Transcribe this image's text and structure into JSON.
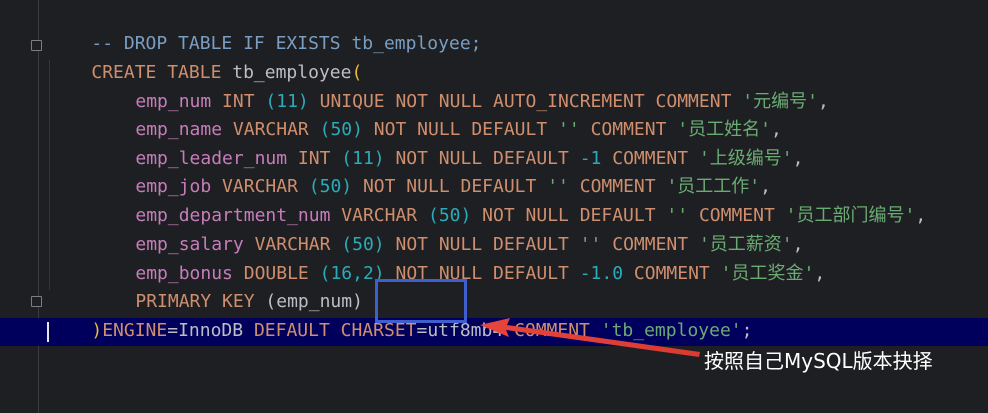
{
  "code": {
    "line1": "-- DROP TABLE IF EXISTS tb_employee;",
    "line2": {
      "create_table": "CREATE TABLE",
      "table_name": " tb_employee",
      "open_paren": "("
    },
    "line3": {
      "column": "emp_num",
      "type": " INT ",
      "size": "(11)",
      "constraints": " UNIQUE NOT NULL AUTO_INCREMENT COMMENT ",
      "comment": "'元编号'",
      "end": ","
    },
    "line4": {
      "column": "emp_name",
      "type": " VARCHAR ",
      "size": "(50)",
      "constraints": " NOT NULL DEFAULT ",
      "default": "''",
      "comment_kw": " COMMENT ",
      "comment": "'员工姓名'",
      "end": ","
    },
    "line5": {
      "column": "emp_leader_num",
      "type": " INT ",
      "size": "(11)",
      "constraints": " NOT NULL DEFAULT ",
      "default": "-1",
      "comment_kw": " COMMENT ",
      "comment": "'上级编号'",
      "end": ","
    },
    "line6": {
      "column": "emp_job",
      "type": " VARCHAR ",
      "size": "(50)",
      "constraints": " NOT NULL DEFAULT ",
      "default": "''",
      "comment_kw": " COMMENT ",
      "comment": "'员工工作'",
      "end": ","
    },
    "line7": {
      "column": "emp_department_num",
      "type": " VARCHAR ",
      "size": "(50)",
      "constraints": " NOT NULL DEFAULT ",
      "default": "''",
      "comment_kw": " COMMENT ",
      "comment": "'员工部门编号'",
      "end": ","
    },
    "line8": {
      "column": "emp_salary",
      "type": " VARCHAR ",
      "size": "(50)",
      "constraints": " NOT NULL DEFAULT ",
      "default": "''",
      "comment_kw": " COMMENT ",
      "comment": "'员工薪资'",
      "end": ","
    },
    "line9": {
      "column": "emp_bonus",
      "type": " DOUBLE ",
      "size": "(16,2)",
      "constraints": " NOT NULL DEFAULT ",
      "default": "-1.0",
      "comment_kw": " COMMENT ",
      "comment": "'员工奖金'",
      "end": ","
    },
    "line10": {
      "primary_key": "PRIMARY KEY ",
      "key_col": "(emp_num)"
    },
    "line11": {
      "close_paren": ")",
      "engine_kw": "ENGINE",
      "engine_eq": "=InnoDB ",
      "default_charset": "DEFAULT CHARSET",
      "charset_value": "=utf8mb4",
      "comment_kw": " COMMENT ",
      "comment": "'tb_employee'",
      "end": ";"
    }
  },
  "annotation": {
    "text": "按照自己MySQL版本抉择"
  },
  "colors": {
    "background": "#1e1f22",
    "current_line": "#00005c",
    "highlight_box": "#3f5fd0",
    "arrow": "#e8453c"
  }
}
